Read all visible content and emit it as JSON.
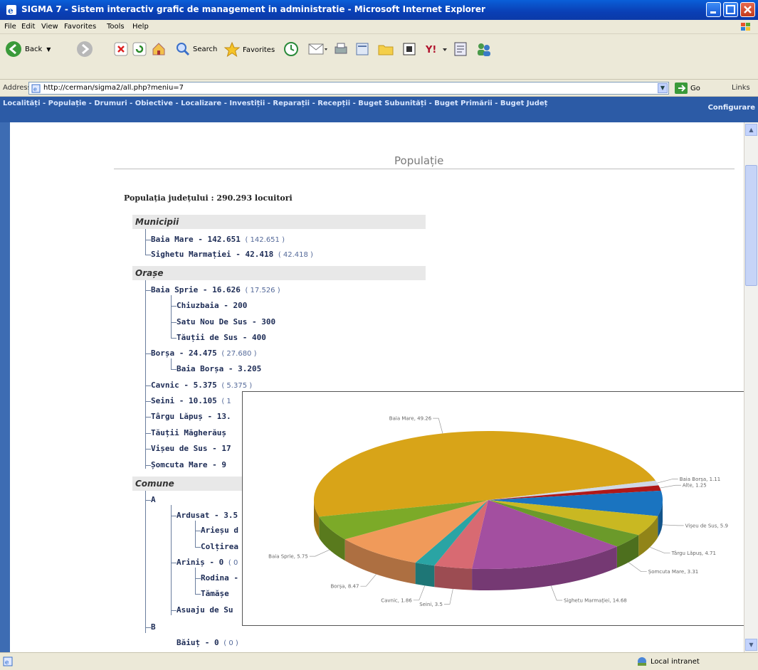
{
  "window": {
    "title": "SIGMA 7 - Sistem interactiv grafic de management in administratie - Microsoft Internet Explorer"
  },
  "menu": [
    "File",
    "Edit",
    "View",
    "Favorites",
    "Tools",
    "Help"
  ],
  "toolbar": {
    "back": "Back",
    "search": "Search",
    "favorites": "Favorites"
  },
  "address": {
    "label": "Address",
    "url": "http://cerman/sigma2/all.php?meniu=7",
    "go": "Go",
    "links": "Links"
  },
  "nav": {
    "line": "Localități - Populație - Drumuri - Obiective - Localizare - Investiții - Reparații - Recepții - Buget Subunități - Buget Primării - Buget Județ",
    "config": "Configurare"
  },
  "page": {
    "title": "Populație",
    "county_total": "Populația județului : 290.293 locuitori"
  },
  "sections": {
    "municipii": "Municipii",
    "orase": "Orașe",
    "comune": "Comune"
  },
  "tree": {
    "baia_mare": {
      "name": "Baia Mare - 142.651",
      "paren": "( 142.651 )"
    },
    "sighetu": {
      "name": "Sighetu Marmației - 42.418",
      "paren": "( 42.418 )"
    },
    "baia_sprie": {
      "name": "Baia Sprie - 16.626",
      "paren": "( 17.526 )"
    },
    "chiuzbaia": {
      "name": "Chiuzbaia - 200"
    },
    "satu_nou": {
      "name": "Satu Nou De Sus - 300"
    },
    "tautii_sus": {
      "name": "Tăuții de Sus - 400"
    },
    "borsa": {
      "name": "Borșa - 24.475",
      "paren": "( 27.680 )"
    },
    "baia_borsa": {
      "name": "Baia Borșa - 3.205"
    },
    "cavnic": {
      "name": "Cavnic - 5.375",
      "paren": "( 5.375 )"
    },
    "seini": {
      "name": "Seini - 10.105",
      "paren": "( 1"
    },
    "targu_lapus": {
      "name": "Târgu Lăpuș - 13."
    },
    "tautii_magh": {
      "name": "Tăuții Măgherăuș"
    },
    "viseu": {
      "name": "Vișeu de Sus - 17"
    },
    "somcuta": {
      "name": "Șomcuta Mare - 9"
    },
    "a": {
      "name": "A"
    },
    "ardusat": {
      "name": "Ardusat - 3.5"
    },
    "ariesu": {
      "name": "Arieșu d"
    },
    "colt": {
      "name": "Colțirea"
    },
    "arinis": {
      "name": "Ariniș - 0",
      "paren": "( 0"
    },
    "rodina": {
      "name": "Rodina -"
    },
    "tamase": {
      "name": "Tămășe"
    },
    "asuaju": {
      "name": "Asuaju de Su"
    },
    "b": {
      "name": "B"
    },
    "baiut": {
      "name": "Băiuț - 0",
      "paren": "( 0 )"
    }
  },
  "status": {
    "zone": "Local intranet"
  },
  "chart_data": {
    "type": "pie",
    "categories": [
      "Baia Mare",
      "Baia Borșa",
      "Alte",
      "Vișeu de Sus",
      "Târgu Lăpuș",
      "Șomcuta Mare",
      "Sighetu Marmației",
      "Seini",
      "Cavnic",
      "Borșa",
      "Baia Sprie"
    ],
    "values": [
      49.26,
      1.11,
      1.25,
      5.9,
      4.71,
      3.31,
      14.68,
      3.5,
      1.86,
      8.47,
      5.75
    ],
    "labels": [
      "Baia Mare, 49.26",
      "Baia Borșa, 1.11",
      "Alte, 1.25",
      "Vișeu de Sus, 5.9",
      "Târgu Lăpuș, 4.71",
      "Șomcuta Mare, 3.31",
      "Sighetu Marmației, 14.68",
      "Seini, 3.5",
      "Cavnic, 1.86",
      "Borșa, 8.47",
      "Baia Sprie, 5.75"
    ],
    "colors": [
      "#d8a418",
      "#cfd8e6",
      "#b01818",
      "#1a74c0",
      "#c9b822",
      "#6b9a2a",
      "#a34fa0",
      "#d86a72",
      "#2aa4a4",
      "#f09a5a",
      "#7caa28"
    ],
    "style": "3d"
  }
}
